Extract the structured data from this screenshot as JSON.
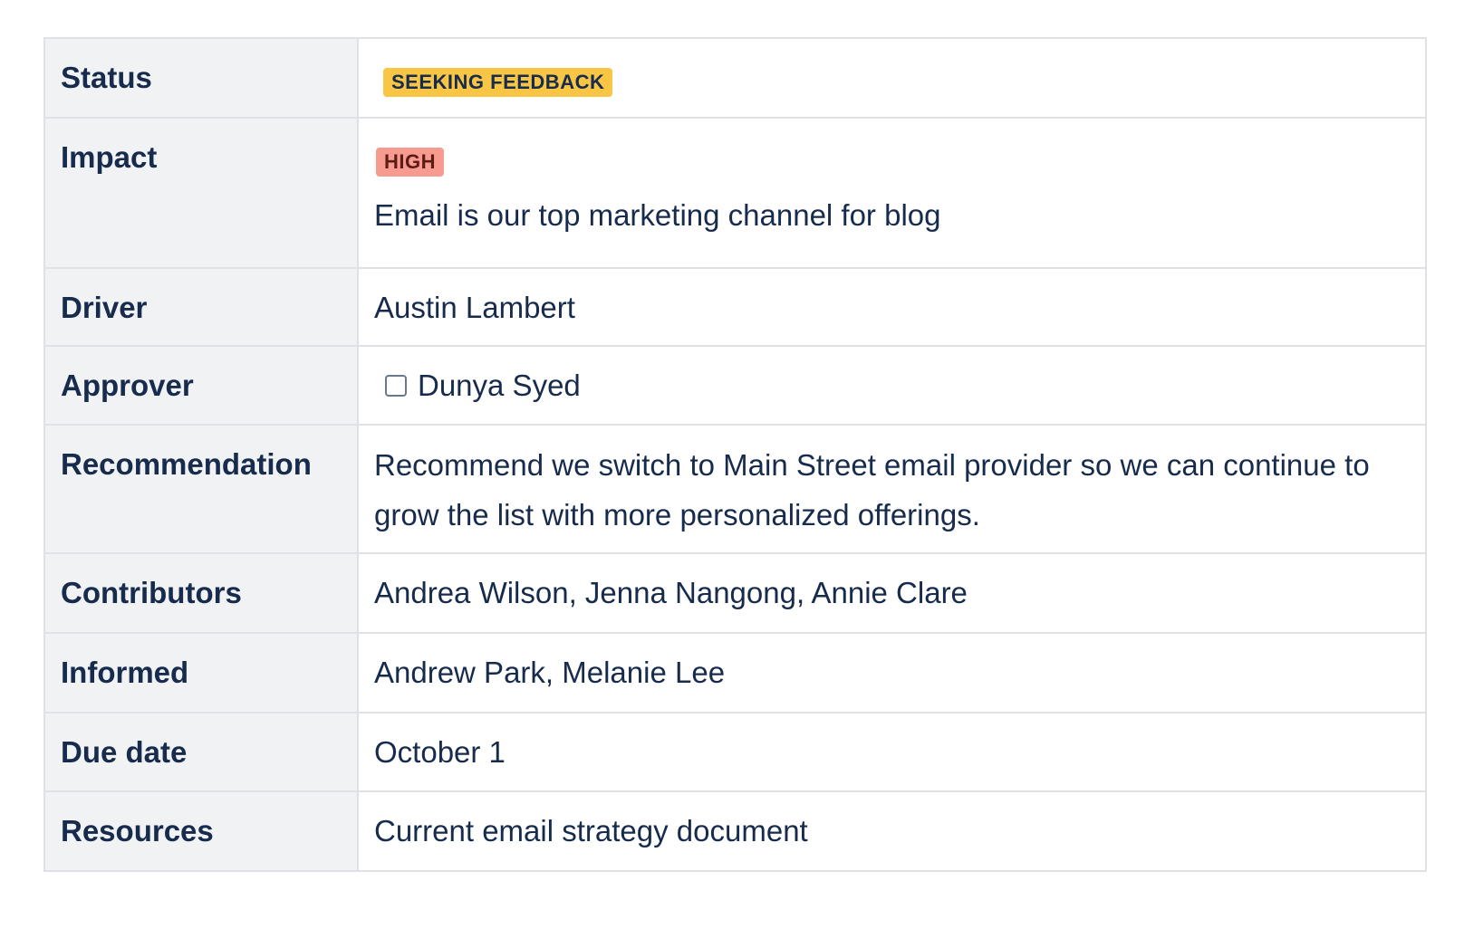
{
  "rows": {
    "status": {
      "label": "Status",
      "lozenge": "SEEKING FEEDBACK",
      "lozenge_color": "#f8c644"
    },
    "impact": {
      "label": "Impact",
      "lozenge": "HIGH",
      "lozenge_color": "#f79b91",
      "text": "Email is our top marketing channel for blog"
    },
    "driver": {
      "label": "Driver",
      "value": "Austin Lambert"
    },
    "approver": {
      "label": "Approver",
      "value": "Dunya Syed",
      "checked": false
    },
    "recommendation": {
      "label": "Recommendation",
      "value": "Recommend we switch to Main Street email provider so we can continue to grow the list with more personalized offerings."
    },
    "contributors": {
      "label": "Contributors",
      "value": "Andrea Wilson, Jenna Nangong, Annie Clare"
    },
    "informed": {
      "label": "Informed",
      "value": "Andrew Park, Melanie Lee"
    },
    "due_date": {
      "label": "Due date",
      "value": "October 1"
    },
    "resources": {
      "label": "Resources",
      "value": "Current email strategy document"
    }
  },
  "colors": {
    "label_background": "#f1f2f4",
    "border": "#dfe1e6",
    "text": "#172b4d"
  }
}
